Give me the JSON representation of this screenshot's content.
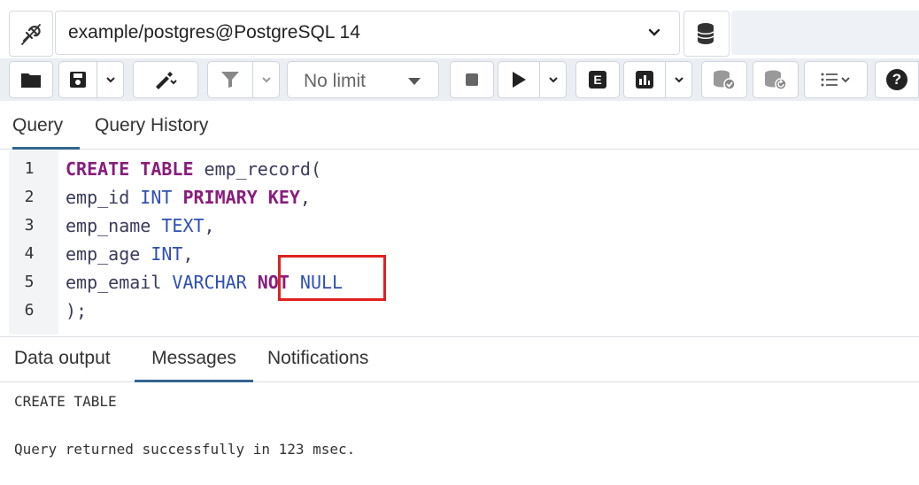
{
  "connection": {
    "label": "example/postgres@PostgreSQL 14"
  },
  "toolbar": {
    "limit_value": "No limit",
    "explain_label": "E",
    "help_label": "?"
  },
  "query_tabs": [
    {
      "label": "Query",
      "active": true
    },
    {
      "label": "Query History",
      "active": false
    }
  ],
  "editor": {
    "line_numbers": [
      "1",
      "2",
      "3",
      "4",
      "5",
      "6"
    ],
    "lines": [
      [
        {
          "t": "CREATE TABLE",
          "c": "kw"
        },
        {
          "t": " emp_record(",
          "c": "pl"
        }
      ],
      [
        {
          "t": "emp_id ",
          "c": "pl"
        },
        {
          "t": "INT",
          "c": "ty"
        },
        {
          "t": " ",
          "c": "pl"
        },
        {
          "t": "PRIMARY KEY",
          "c": "kw"
        },
        {
          "t": ",",
          "c": "pl"
        }
      ],
      [
        {
          "t": "emp_name ",
          "c": "pl"
        },
        {
          "t": "TEXT",
          "c": "ty"
        },
        {
          "t": ",",
          "c": "pl"
        }
      ],
      [
        {
          "t": "emp_age ",
          "c": "pl"
        },
        {
          "t": "INT",
          "c": "ty"
        },
        {
          "t": ",",
          "c": "pl"
        }
      ],
      [
        {
          "t": "emp_email ",
          "c": "pl"
        },
        {
          "t": "VARCHAR",
          "c": "ty"
        },
        {
          "t": " ",
          "c": "pl"
        },
        {
          "t": "NOT",
          "c": "kw"
        },
        {
          "t": " NULL",
          "c": "ty"
        }
      ],
      [
        {
          "t": ");",
          "c": "pl"
        }
      ]
    ]
  },
  "result_tabs": [
    {
      "label": "Data output",
      "active": false
    },
    {
      "label": "Messages",
      "active": true
    },
    {
      "label": "Notifications",
      "active": false
    }
  ],
  "messages": {
    "line1": "CREATE TABLE",
    "line2": "Query returned successfully in 123 msec."
  },
  "colors": {
    "keyword": "#8a1c7c",
    "type": "#2f4fb5",
    "active_tab_underline": "#326690",
    "highlight_border": "#e02020"
  }
}
